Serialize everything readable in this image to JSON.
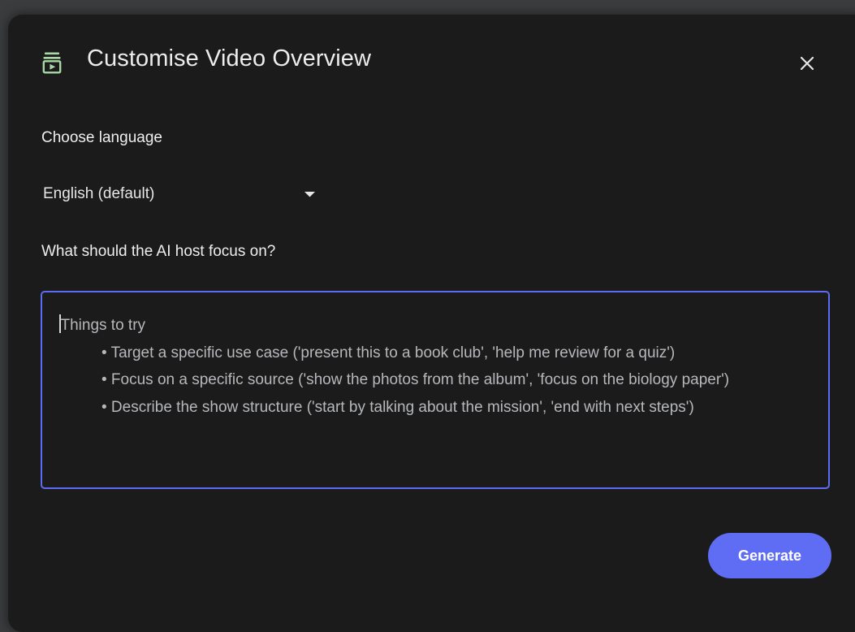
{
  "dialog": {
    "title": "Customise Video Overview",
    "icon": "video-overview-icon",
    "close_icon": "close-icon"
  },
  "language": {
    "label": "Choose language",
    "selected": "English (default)",
    "dropdown_icon": "dropdown-arrow-icon"
  },
  "focus": {
    "label": "What should the AI host focus on?",
    "placeholder": {
      "heading": "Things to try",
      "items": [
        "• Target a specific use case ('present this to a book club', 'help me review for a quiz')",
        "• Focus on a specific source ('show the photos from the album', 'focus on the biology paper')",
        "• Describe the show structure ('start by talking about the mission', 'end with next steps')"
      ]
    }
  },
  "actions": {
    "generate_label": "Generate"
  },
  "colors": {
    "dialog_bg": "#1b1b1c",
    "accent": "#5f6cf4",
    "focus_border": "#5b6cf5",
    "icon_green": "#a9d7a5"
  }
}
